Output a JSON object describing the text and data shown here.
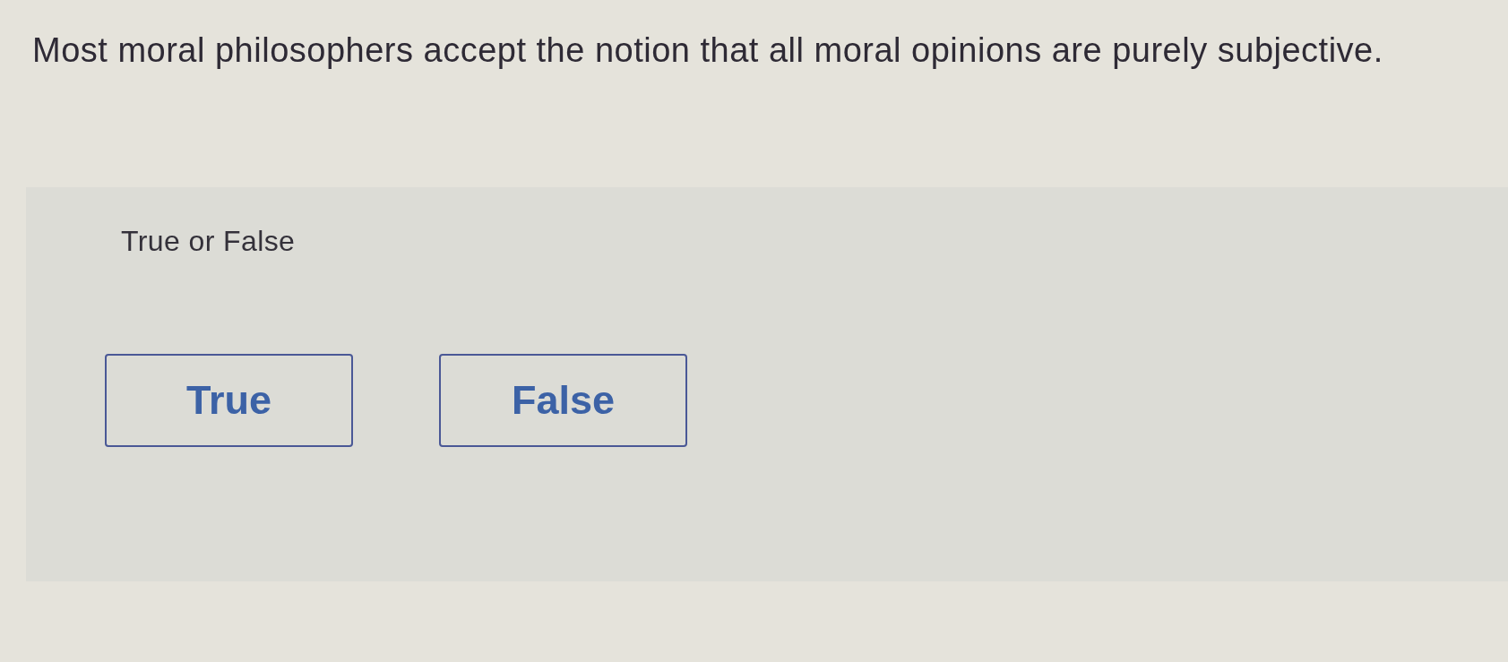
{
  "question": {
    "text": "Most moral philosophers accept the notion that all moral opinions are purely subjective."
  },
  "answer_panel": {
    "prompt": "True or False",
    "options": [
      {
        "label": "True",
        "selected": false
      },
      {
        "label": "False",
        "selected": false
      }
    ]
  }
}
